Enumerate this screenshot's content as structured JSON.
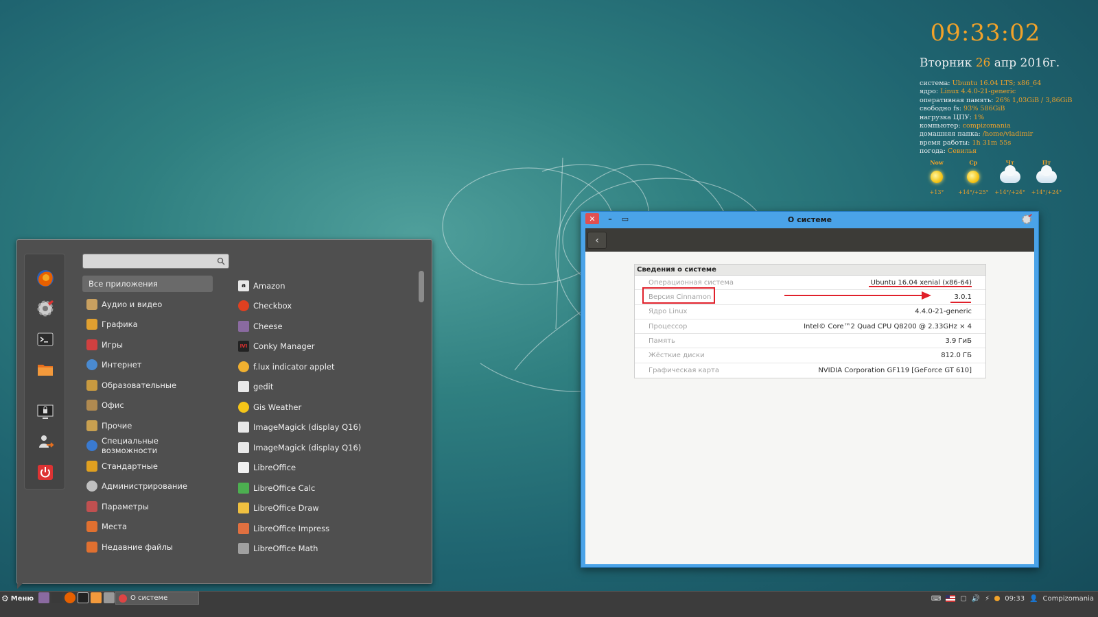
{
  "conky": {
    "time": "09:33:02",
    "weekday": "Вторник",
    "day": "26",
    "month_year": "апр 2016г.",
    "info": [
      {
        "label": "система:",
        "value": "Ubuntu 16.04 LTS; x86_64"
      },
      {
        "label": "ядро:",
        "value": "Linux 4.4.0-21-generic"
      },
      {
        "label": "оперативная память:",
        "value": "26% 1,03GiB / 3,86GiB"
      },
      {
        "label": "свободно fs:",
        "value": "93% 586GiB"
      },
      {
        "label": "нагрузка ЦПУ:",
        "value": "1%"
      },
      {
        "label": "компьютер:",
        "value": "compizomania"
      },
      {
        "label": "домашняя папка:",
        "value": "/home/vladimir"
      },
      {
        "label": "время работы:",
        "value": "1h 31m 55s"
      },
      {
        "label": "погода:",
        "value": "Севилья"
      }
    ],
    "weather": [
      {
        "day": "Now",
        "icon": "sun-icon",
        "temp": "+13°"
      },
      {
        "day": "Ср",
        "icon": "sun-icon",
        "temp": "+14°/+25°"
      },
      {
        "day": "Чт",
        "icon": "cloud-icon",
        "temp": "+14°/+24°"
      },
      {
        "day": "Пт",
        "icon": "cloud-icon",
        "temp": "+14°/+24°"
      }
    ]
  },
  "menu": {
    "search": {
      "value": "",
      "placeholder": ""
    },
    "favorites": [
      "firefox-icon",
      "settings-icon",
      "terminal-icon",
      "folder-icon",
      "lock-screen-icon",
      "logout-icon",
      "power-icon"
    ],
    "categories": [
      {
        "label": "Все приложения",
        "icon": "all-apps-icon",
        "color": "#6a6a6a"
      },
      {
        "label": "Аудио и видео",
        "icon": "audio-video-icon",
        "color": "#c8a060"
      },
      {
        "label": "Графика",
        "icon": "graphics-icon",
        "color": "#e0a030"
      },
      {
        "label": "Игры",
        "icon": "games-icon",
        "color": "#d04040"
      },
      {
        "label": "Интернет",
        "icon": "internet-icon",
        "color": "#4a8ad0"
      },
      {
        "label": "Образовательные",
        "icon": "education-icon",
        "color": "#c89a40"
      },
      {
        "label": "Офис",
        "icon": "office-icon",
        "color": "#b08a50"
      },
      {
        "label": "Прочие",
        "icon": "other-icon",
        "color": "#c8a050"
      },
      {
        "label": "Специальные возможности",
        "icon": "accessibility-icon",
        "color": "#3a7ad0"
      },
      {
        "label": "Стандартные",
        "icon": "accessories-icon",
        "color": "#e0a020"
      },
      {
        "label": "Администрирование",
        "icon": "administration-icon",
        "color": "#c0c0c0"
      },
      {
        "label": "Параметры",
        "icon": "preferences-icon",
        "color": "#c05050"
      },
      {
        "label": "Места",
        "icon": "places-icon",
        "color": "#e07030"
      },
      {
        "label": "Недавние файлы",
        "icon": "recent-files-icon",
        "color": "#e07030"
      }
    ],
    "apps": [
      {
        "label": "Amazon",
        "icon": "amazon-icon",
        "color": "#e8e8e8",
        "glyph": "a"
      },
      {
        "label": "Checkbox",
        "icon": "checkbox-icon",
        "color": "#e04020",
        "glyph": ""
      },
      {
        "label": "Cheese",
        "icon": "cheese-icon",
        "color": "#8a6aa0",
        "glyph": ""
      },
      {
        "label": "Conky Manager",
        "icon": "conky-manager-icon",
        "color": "#c03030",
        "glyph": "IVI"
      },
      {
        "label": "f.lux indicator applet",
        "icon": "flux-icon",
        "color": "#f0b030",
        "glyph": ""
      },
      {
        "label": "gedit",
        "icon": "gedit-icon",
        "color": "#e8e8e8",
        "glyph": ""
      },
      {
        "label": "Gis Weather",
        "icon": "gis-weather-icon",
        "color": "#f5c518",
        "glyph": ""
      },
      {
        "label": "ImageMagick (display Q16)",
        "icon": "imagemagick-icon",
        "color": "#e8e8e8",
        "glyph": ""
      },
      {
        "label": "ImageMagick (display Q16)",
        "icon": "imagemagick-icon",
        "color": "#e8e8e8",
        "glyph": ""
      },
      {
        "label": "LibreOffice",
        "icon": "libreoffice-icon",
        "color": "#f0f0f0",
        "glyph": ""
      },
      {
        "label": "LibreOffice Calc",
        "icon": "libreoffice-calc-icon",
        "color": "#4caf50",
        "glyph": ""
      },
      {
        "label": "LibreOffice Draw",
        "icon": "libreoffice-draw-icon",
        "color": "#f0c040",
        "glyph": ""
      },
      {
        "label": "LibreOffice Impress",
        "icon": "libreoffice-impress-icon",
        "color": "#e07040",
        "glyph": ""
      },
      {
        "label": "LibreOffice Math",
        "icon": "libreoffice-math-icon",
        "color": "#a0a0a0",
        "glyph": ""
      }
    ]
  },
  "window": {
    "title": "О системе",
    "back_label": "‹",
    "section_title": "Сведения о системе",
    "rows": [
      {
        "label": "Операционная система",
        "value": "Ubuntu 16.04 xenial (x86-64)"
      },
      {
        "label": "Версия Cinnamon",
        "value": "3.0.1"
      },
      {
        "label": "Ядро Linux",
        "value": "4.4.0-21-generic"
      },
      {
        "label": "Процессор",
        "value": "Intel© Core™2 Quad  CPU   Q8200  @ 2.33GHz × 4"
      },
      {
        "label": "Память",
        "value": "3.9 ГиБ"
      },
      {
        "label": "Жёсткие диски",
        "value": "812.0 ГБ"
      },
      {
        "label": "Графическая карта",
        "value": "NVIDIA Corporation GF119 [GeForce GT 610]"
      }
    ]
  },
  "taskbar": {
    "menu_label": "Меню",
    "task_label": "О системе",
    "clock": "09:33",
    "user": "Compizomania",
    "accent": "#f0a22a"
  }
}
